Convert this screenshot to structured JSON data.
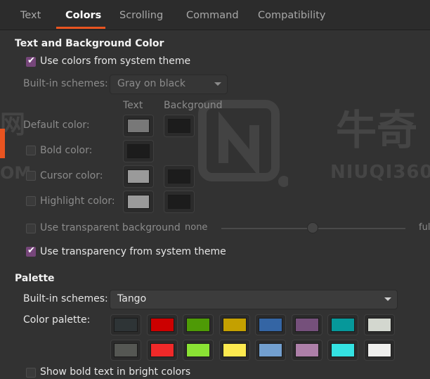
{
  "tabs": [
    "Text",
    "Colors",
    "Scrolling",
    "Command",
    "Compatibility"
  ],
  "active_tab": "Colors",
  "accent_color": "#e95420",
  "check_color": "#76467a",
  "text_bg": {
    "heading": "Text and Background Color",
    "use_system_theme": {
      "label": "Use colors from system theme",
      "checked": true
    },
    "builtin_label": "Built-in schemes:",
    "builtin_value": "Gray on black",
    "col_text": "Text",
    "col_background": "Background",
    "default_color": "Default color:",
    "bold_color": "Bold color:",
    "cursor_color": "Cursor color:",
    "highlight_color": "Highlight color:",
    "swatch_text_default": "#787878",
    "swatch_bg_default": "#1c1c1c",
    "swatch_bold": "#1c1c1c",
    "swatch_cursor_text": "#9a9a9a",
    "swatch_cursor_bg": "#1c1c1c",
    "swatch_highlight_text": "#9a9a9a",
    "swatch_highlight_bg": "#1c1c1c",
    "transparent_bg": {
      "label": "Use transparent background",
      "checked": false
    },
    "slider_none": "none",
    "slider_full": "full",
    "transparency_system": {
      "label": "Use transparency from system theme",
      "checked": true
    }
  },
  "palette": {
    "heading": "Palette",
    "builtin_label": "Built-in schemes:",
    "builtin_value": "Tango",
    "color_palette_label": "Color palette:",
    "row1": [
      "#2e3436",
      "#cc0000",
      "#4e9a06",
      "#c4a000",
      "#3465a4",
      "#75507b",
      "#06989a",
      "#d3d7cf"
    ],
    "row2": [
      "#555753",
      "#ef2929",
      "#8ae234",
      "#fce94f",
      "#729fcf",
      "#ad7fa8",
      "#34e2e2",
      "#eeeeec"
    ],
    "bold_bright": {
      "label": "Show bold text in bright colors",
      "checked": false
    }
  },
  "watermark": {
    "text1": "牛奇",
    "text2": "NIUQI360",
    "text3": "网",
    "text4": "OM"
  }
}
